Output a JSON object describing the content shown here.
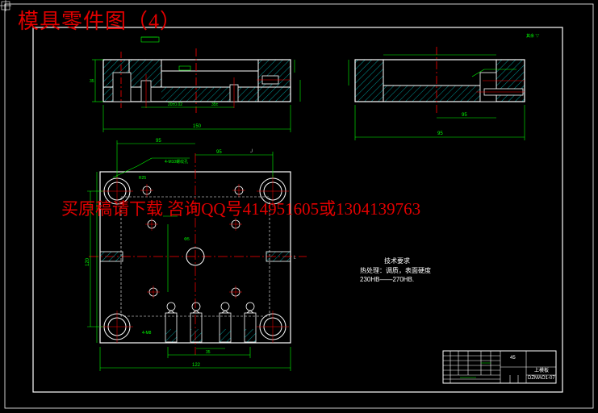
{
  "watermark": {
    "title": "模具零件图（4）",
    "banner": "买原稿请下载 咨询QQ号414951605或1304139763"
  },
  "technical_requirements": {
    "heading": "技术要求",
    "line1": "热处理：调质，表面硬度",
    "line2": "230HB——270HB."
  },
  "title_block": {
    "material": "45",
    "part_name": "上模板",
    "drawing_no": "DZMAO1-07"
  },
  "dimensions": {
    "top_overall": "150",
    "right_overall": "95",
    "plan_width": "120",
    "plan_bottom": "122"
  },
  "colors": {
    "outline": "#ffffff",
    "dimension": "#00ff00",
    "centerline": "#ff0000",
    "hatch": "#00ffff",
    "watermark": "#e00000"
  }
}
